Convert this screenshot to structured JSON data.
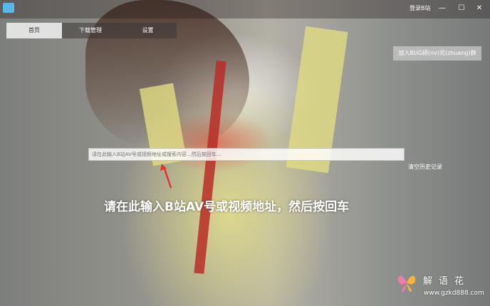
{
  "window": {
    "login_label": "登录B站",
    "min_icon": "minimize-icon",
    "max_icon": "maximize-icon",
    "close_icon": "close-icon"
  },
  "tabs": [
    {
      "label": "首页",
      "active": true
    },
    {
      "label": "下载管理",
      "active": false
    },
    {
      "label": "设置",
      "active": false
    }
  ],
  "join_button": "加入BUG研(nv)究(zhuang)群",
  "search": {
    "placeholder": "请在此输入B站AV号或视频地址或搜索内容...然后按回车..."
  },
  "clear_history": "清空历史记录",
  "hint_text": "请在此输入B站AV号或视频地址，然后按回车",
  "watermark": {
    "logo": "butterfly-logo",
    "text": "解语花",
    "url": "www.gzkd888.com"
  },
  "colors": {
    "arrow": "#e0372c",
    "app_icon": "#59b7e9"
  }
}
